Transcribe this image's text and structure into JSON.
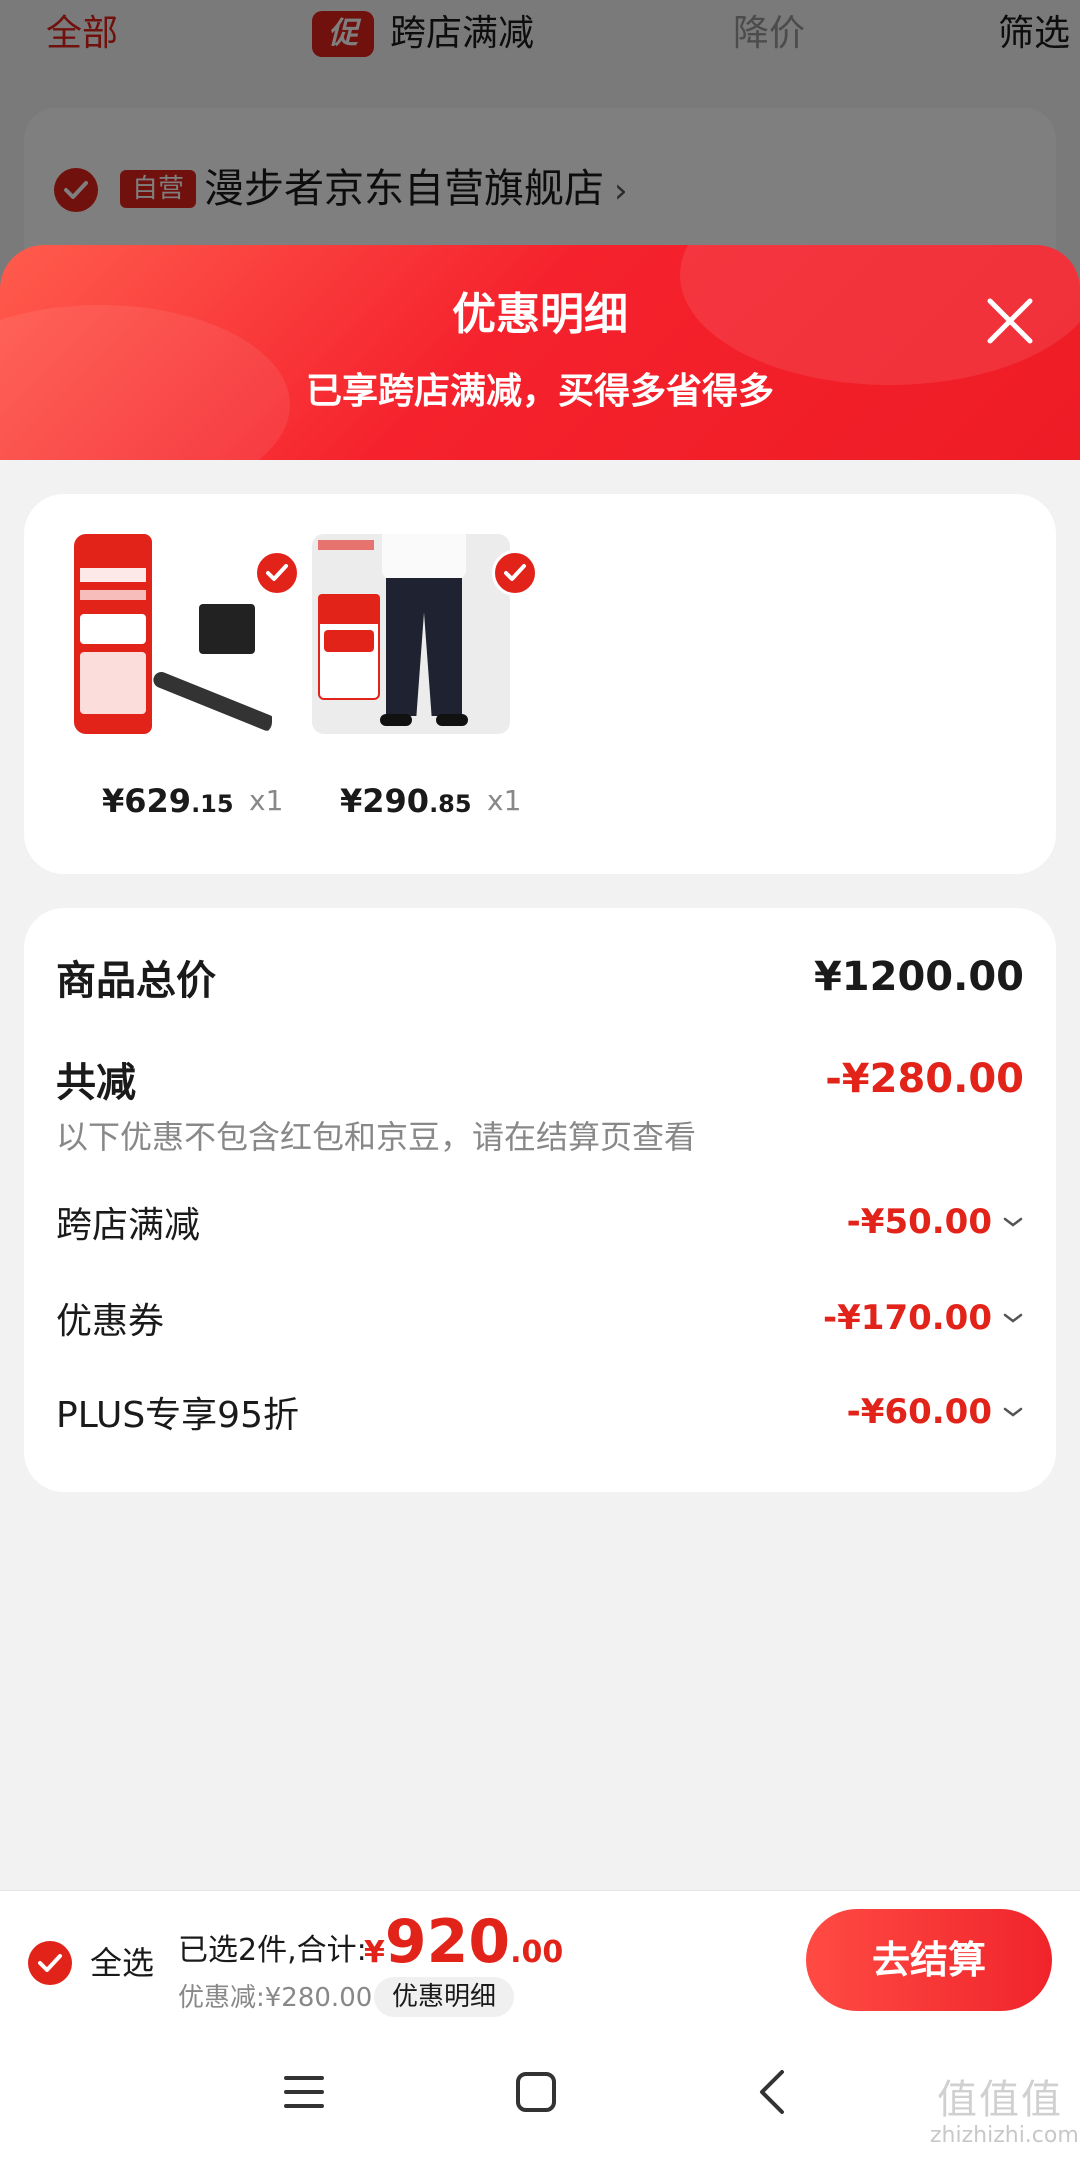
{
  "filter_bar": {
    "all": "全部",
    "promo_badge": "促",
    "promo_label": "跨店满减",
    "price_drop": "降价",
    "filter": "筛选"
  },
  "store": {
    "self_tag": "自营",
    "name": "漫步者京东自营旗舰店",
    "chevron": "›"
  },
  "sheet": {
    "title": "优惠明细",
    "subtitle": "已享跨店满减，买得多省得多"
  },
  "products": [
    {
      "price_int": "¥629",
      "price_dec": ".15",
      "qty": "x1",
      "image": "soundbar-product-image"
    },
    {
      "price_int": "¥290",
      "price_dec": ".85",
      "qty": "x1",
      "image": "trousers-product-image"
    }
  ],
  "summary": {
    "total_label": "商品总价",
    "total_value": "¥1200.00",
    "reduction_label": "共减",
    "reduction_value": "-¥280.00",
    "note": "以下优惠不包含红包和京豆，请在结算页查看",
    "items": [
      {
        "label": "跨店满减",
        "value": "-¥50.00"
      },
      {
        "label": "优惠券",
        "value": "-¥170.00"
      },
      {
        "label": "PLUS专享95折",
        "value": "-¥60.00"
      }
    ]
  },
  "checkout": {
    "select_all": "全选",
    "selected_text": "已选2件,合计:",
    "currency": "¥",
    "total_int": "920",
    "total_dec": ".00",
    "saved_text": "优惠减:¥280.00",
    "detail_button": "优惠明细",
    "checkout_button": "去结算"
  },
  "watermark": {
    "big": "值值值",
    "small": "zhizhizhi.com"
  },
  "colors": {
    "accent": "#e2231a",
    "header_gradient_start": "#ff5c4d",
    "header_gradient_end": "#ee1c25",
    "background": "#f2f2f2"
  }
}
